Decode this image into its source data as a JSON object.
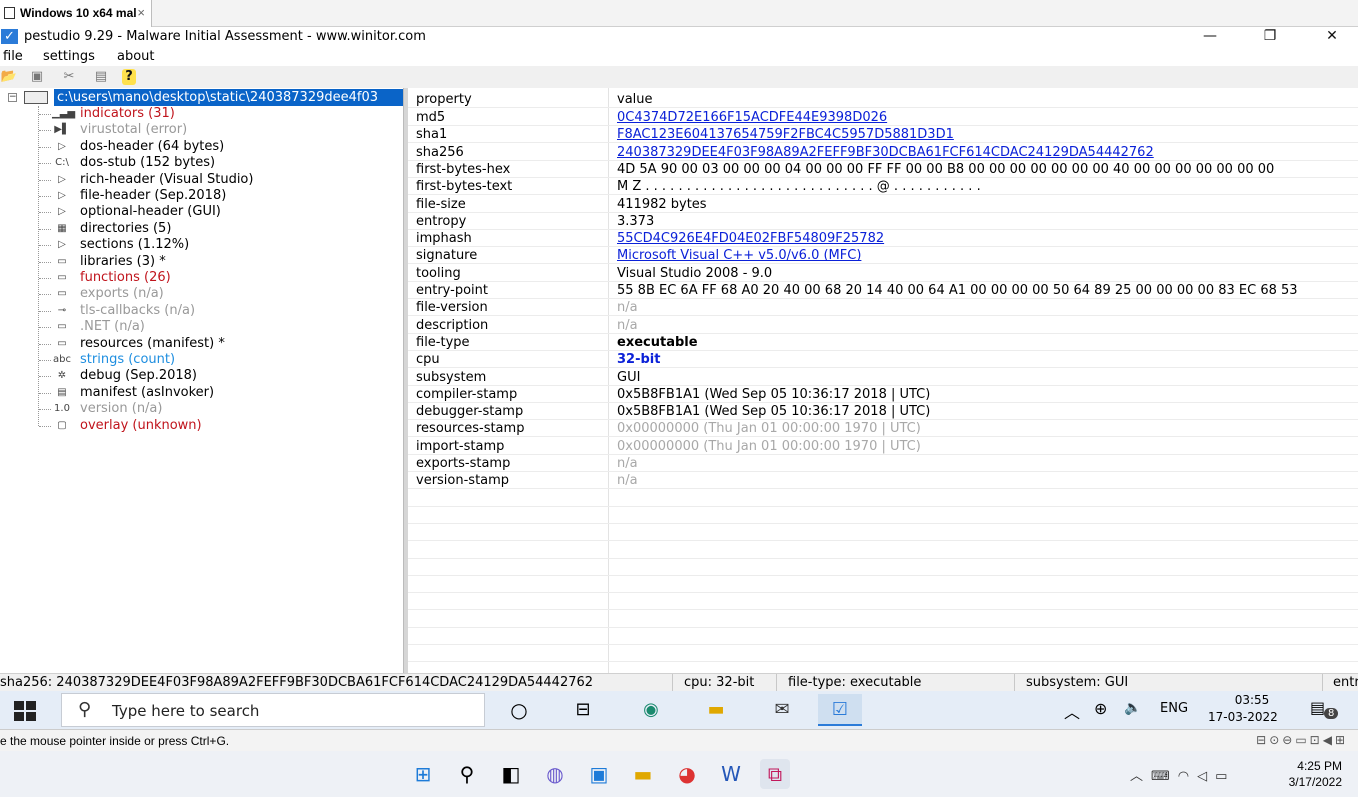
{
  "vm_tab": {
    "title": "Windows 10 x64 mal",
    "close": "×"
  },
  "window": {
    "title": "pestudio 9.29 - Malware Initial Assessment - www.winitor.com",
    "minimize": "—",
    "maximize": "❐",
    "close": "✕"
  },
  "menu": [
    "file",
    "settings",
    "about"
  ],
  "toolbar_icons": [
    "open-icon",
    "save-icon",
    "cut-icon",
    "clipboard-icon",
    "help-icon"
  ],
  "tree": {
    "root": "c:\\users\\mano\\desktop\\static\\240387329dee4f03",
    "items": [
      {
        "label": "indicators (31)",
        "style": "red",
        "icon": "▁▃▅"
      },
      {
        "label": "virustotal (error)",
        "style": "gray",
        "icon": "▶▌"
      },
      {
        "label": "dos-header (64 bytes)",
        "style": "",
        "icon": "▷"
      },
      {
        "label": "dos-stub (152 bytes)",
        "style": "",
        "icon": "C:\\"
      },
      {
        "label": "rich-header (Visual Studio)",
        "style": "",
        "icon": "▷"
      },
      {
        "label": "file-header (Sep.2018)",
        "style": "",
        "icon": "▷"
      },
      {
        "label": "optional-header (GUI)",
        "style": "",
        "icon": "▷"
      },
      {
        "label": "directories (5)",
        "style": "",
        "icon": "▦"
      },
      {
        "label": "sections (1.12%)",
        "style": "",
        "icon": "▷"
      },
      {
        "label": "libraries (3) *",
        "style": "",
        "icon": "▭"
      },
      {
        "label": "functions (26)",
        "style": "red",
        "icon": "▭"
      },
      {
        "label": "exports (n/a)",
        "style": "gray",
        "icon": "▭"
      },
      {
        "label": "tls-callbacks (n/a)",
        "style": "gray",
        "icon": "⊸"
      },
      {
        "label": ".NET (n/a)",
        "style": "gray",
        "icon": "▭"
      },
      {
        "label": "resources (manifest) *",
        "style": "",
        "icon": "▭"
      },
      {
        "label": "strings (count)",
        "style": "blue",
        "icon": "abc"
      },
      {
        "label": "debug (Sep.2018)",
        "style": "",
        "icon": "✲"
      },
      {
        "label": "manifest (asInvoker)",
        "style": "",
        "icon": "▤"
      },
      {
        "label": "version (n/a)",
        "style": "gray",
        "icon": "1.0"
      },
      {
        "label": "overlay (unknown)",
        "style": "red",
        "icon": "▢"
      }
    ]
  },
  "properties": {
    "header": {
      "key": "property",
      "value": "value"
    },
    "rows": [
      {
        "key": "md5",
        "value": "0C4374D72E166F15ACDFE44E9398D026",
        "style": "link"
      },
      {
        "key": "sha1",
        "value": "F8AC123E604137654759F2FBC4C5957D5881D3D1",
        "style": "link"
      },
      {
        "key": "sha256",
        "value": "240387329DEE4F03F98A89A2FEFF9BF30DCBA61FCF614CDAC24129DA54442762",
        "style": "link"
      },
      {
        "key": "first-bytes-hex",
        "value": "4D 5A 90 00 03 00 00 00 04 00 00 00 FF FF 00 00 B8 00 00 00 00 00 00 00 40 00 00 00 00 00 00 00",
        "style": ""
      },
      {
        "key": "first-bytes-text",
        "value": "M Z . . . . . . . . . . . . . . . . . . . . . . . . . . . . @ . . . . . . . . . . .",
        "style": ""
      },
      {
        "key": "file-size",
        "value": "411982 bytes",
        "style": ""
      },
      {
        "key": "entropy",
        "value": "3.373",
        "style": ""
      },
      {
        "key": "imphash",
        "value": "55CD4C926E4FD04E02FBF54809F25782",
        "style": "link"
      },
      {
        "key": "signature",
        "value": "Microsoft Visual C++ v5.0/v6.0 (MFC)",
        "style": "link"
      },
      {
        "key": "tooling",
        "value": "Visual Studio 2008 - 9.0",
        "style": ""
      },
      {
        "key": "entry-point",
        "value": "55 8B EC 6A FF 68 A0 20 40 00 68 20 14 40 00 64 A1 00 00 00 00 50 64 89 25 00 00 00 00 83 EC 68 53",
        "style": ""
      },
      {
        "key": "file-version",
        "value": "n/a",
        "style": "muted"
      },
      {
        "key": "description",
        "value": "n/a",
        "style": "muted"
      },
      {
        "key": "file-type",
        "value": "executable",
        "style": "bold"
      },
      {
        "key": "cpu",
        "value": "32-bit",
        "style": "boldblue"
      },
      {
        "key": "subsystem",
        "value": "GUI",
        "style": ""
      },
      {
        "key": "compiler-stamp",
        "value": "0x5B8FB1A1 (Wed Sep 05 10:36:17 2018 | UTC)",
        "style": ""
      },
      {
        "key": "debugger-stamp",
        "value": "0x5B8FB1A1 (Wed Sep 05 10:36:17 2018 | UTC)",
        "style": ""
      },
      {
        "key": "resources-stamp",
        "value": "0x00000000 (Thu Jan 01 00:00:00 1970 | UTC)",
        "style": "muted"
      },
      {
        "key": "import-stamp",
        "value": "0x00000000 (Thu Jan 01 00:00:00 1970 | UTC)",
        "style": "muted"
      },
      {
        "key": "exports-stamp",
        "value": "n/a",
        "style": "muted"
      },
      {
        "key": "version-stamp",
        "value": "n/a",
        "style": "muted"
      }
    ]
  },
  "statusbar": {
    "sha256": "sha256: 240387329DEE4F03F98A89A2FEFF9BF30DCBA61FCF614CDAC24129DA54442762",
    "cpu": "cpu: 32-bit",
    "filetype": "file-type: executable",
    "subsystem": "subsystem: GUI",
    "entry": "entr"
  },
  "taskbar": {
    "search_placeholder": "Type here to search",
    "lang": "ENG",
    "time": "03:55",
    "date": "17-03-2022",
    "notifications": "8"
  },
  "vm_status": {
    "message": "e the mouse pointer inside or press Ctrl+G."
  },
  "host": {
    "time": "4:25 PM",
    "date": "3/17/2022"
  },
  "colors": {
    "selection": "#0a64c8",
    "link": "#0b21d8",
    "red": "#c0141c",
    "taskbar": "#e5edf7"
  }
}
